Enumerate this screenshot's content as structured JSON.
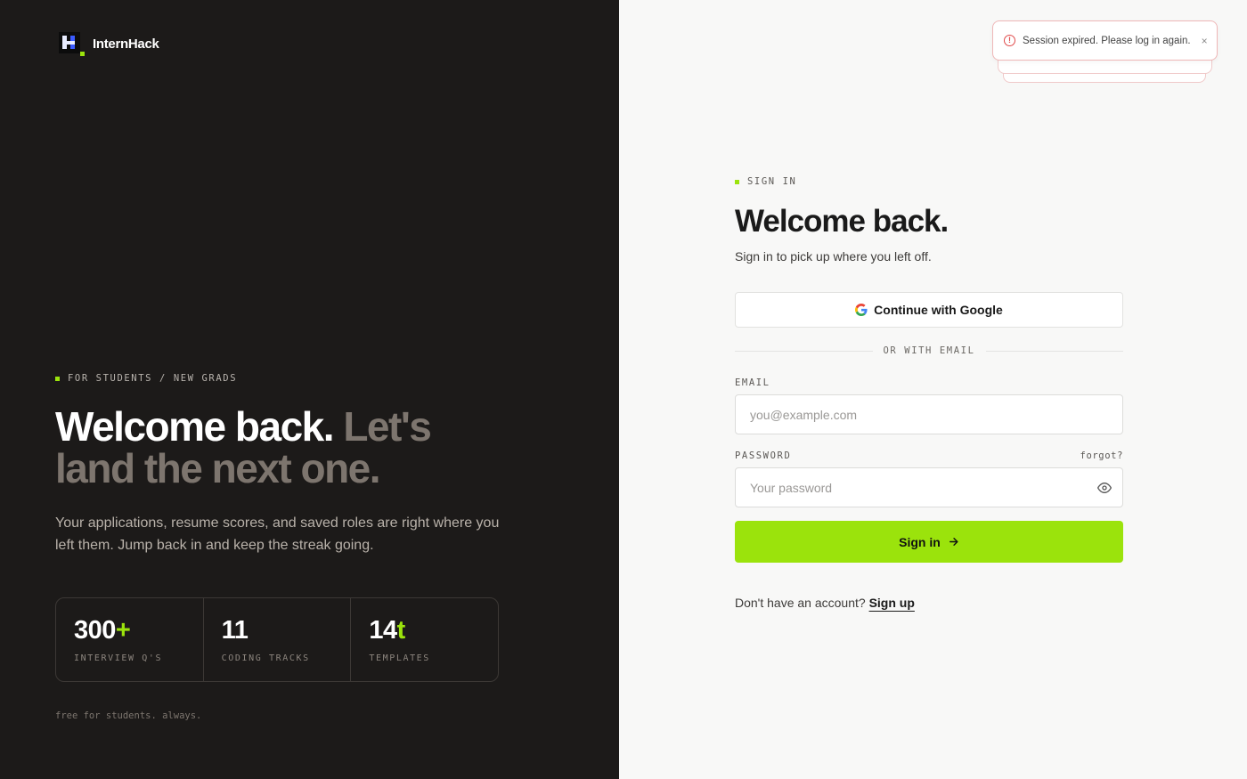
{
  "brand": {
    "name": "InternHack"
  },
  "left": {
    "eyebrow": "FOR STUDENTS / NEW GRADS",
    "hero_white": "Welcome back.",
    "hero_gray": "Let's land the next one.",
    "lede": "Your applications, resume scores, and saved roles are right where you left them. Jump back in and keep the streak going.",
    "stats": [
      {
        "value": "300",
        "accent": "+",
        "label": "INTERVIEW Q'S"
      },
      {
        "value": "11",
        "accent": "",
        "label": "CODING TRACKS"
      },
      {
        "value": "14",
        "accent": "t",
        "label": "TEMPLATES"
      }
    ],
    "footnote": "free for students. always."
  },
  "toast": {
    "message": "Session expired. Please log in again.",
    "close": "×",
    "icon": "alert-circle-icon"
  },
  "form": {
    "eyebrow": "SIGN IN",
    "title": "Welcome back.",
    "subtitle": "Sign in to pick up where you left off.",
    "google_label": "Continue with Google",
    "divider": "OR WITH EMAIL",
    "email_label": "EMAIL",
    "email_placeholder": "you@example.com",
    "email_value": "",
    "password_label": "PASSWORD",
    "forgot_label": "forgot?",
    "password_placeholder": "Your password",
    "password_value": "",
    "signin_label": "Sign in",
    "signup_prompt": "Don't have an account?",
    "signup_link": "Sign up"
  },
  "colors": {
    "accent": "#9be30c",
    "left_bg": "#1c1a19",
    "right_bg": "#f8f8f7",
    "error": "#e04b4b"
  }
}
